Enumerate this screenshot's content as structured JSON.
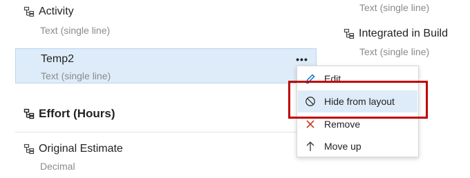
{
  "left_fields": {
    "activity": {
      "label": "Activity",
      "type": "Text (single line)",
      "icon": "field-hierarchy-icon"
    },
    "temp2": {
      "label": "Temp2",
      "type": "Text (single line)",
      "more_label": "•••"
    },
    "effort_group": {
      "label": "Effort (Hours)",
      "icon": "field-hierarchy-icon"
    },
    "original_estimate": {
      "label": "Original Estimate",
      "type": "Decimal",
      "icon": "field-hierarchy-icon"
    }
  },
  "right_fields": {
    "top_partial_type": "Text (single line)",
    "integrated_in_build": {
      "label": "Integrated in Build",
      "type": "Text (single line)",
      "icon": "field-hierarchy-icon"
    }
  },
  "context_menu": {
    "items": [
      {
        "label": "Edit",
        "icon": "pencil-icon"
      },
      {
        "label": "Hide from layout",
        "icon": "hide-circle-slash-icon"
      },
      {
        "label": "Remove",
        "icon": "remove-x-icon"
      },
      {
        "label": "Move up",
        "icon": "arrow-up-icon"
      }
    ]
  },
  "colors": {
    "selection": "#deecf9",
    "accent": "#0078d4",
    "remove_red": "#c43e1c",
    "highlight_red": "#c00000"
  }
}
